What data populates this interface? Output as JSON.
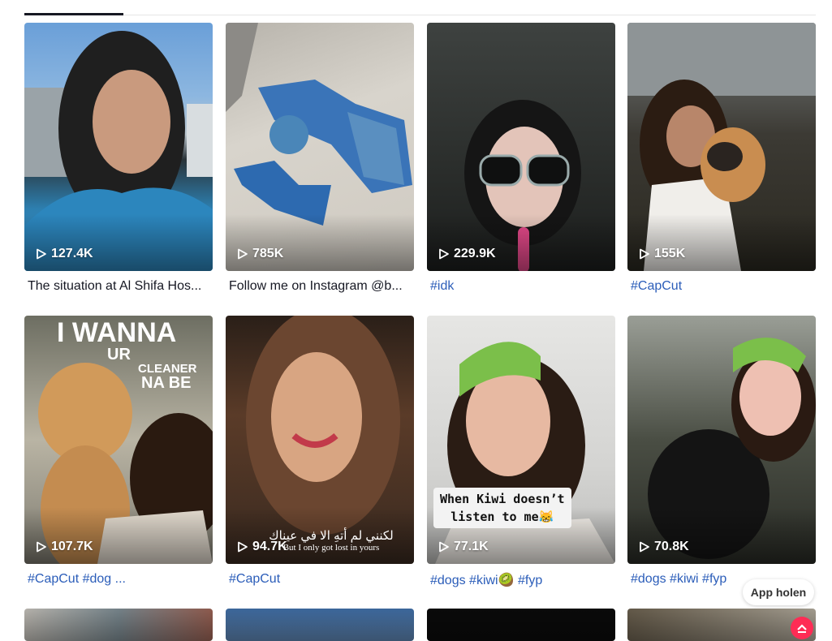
{
  "videos": [
    {
      "views": "127.4K",
      "caption": "The situation at Al Shifa Hos...",
      "is_tag": false
    },
    {
      "views": "785K",
      "caption": "Follow me on Instagram @b...",
      "is_tag": false
    },
    {
      "views": "229.9K",
      "caption": "#idk",
      "is_tag": true
    },
    {
      "views": "155K",
      "caption": "#CapCut",
      "is_tag": true
    },
    {
      "views": "107.7K",
      "caption": "#CapCut #dog ...",
      "is_tag": true,
      "overlay": [
        "I WANNA",
        "UR",
        "CLEANER",
        "NA BE"
      ]
    },
    {
      "views": "94.7K",
      "caption": "#CapCut",
      "is_tag": true,
      "overlay": [
        "لكنني لم أتهِ الا في عيناك",
        "But I only got lost in yours"
      ]
    },
    {
      "views": "77.1K",
      "caption": "#dogs #kiwi🥝 #fyp",
      "is_tag": true,
      "sticker": [
        "When Kiwi doesn’t",
        "listen to me😹"
      ]
    },
    {
      "views": "70.8K",
      "caption": "#dogs #kiwi #fyp",
      "is_tag": true
    }
  ],
  "app_button": {
    "label": "App holen"
  },
  "colors": {
    "accent": "#fe2c55",
    "hashtag": "#2b5db9",
    "text": "#161823"
  }
}
